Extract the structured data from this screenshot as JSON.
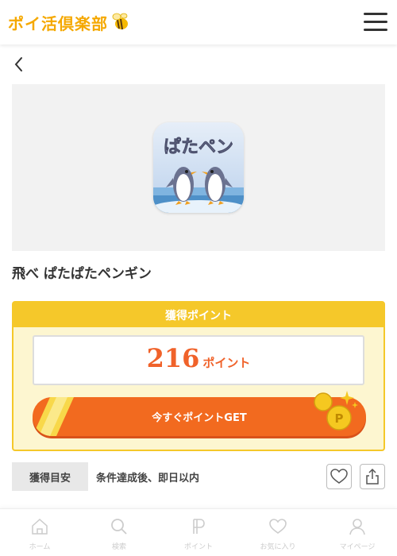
{
  "header": {
    "logo_text": "ポイ活倶楽部",
    "logo_icon": "bee-icon",
    "menu_icon": "hamburger-menu-icon"
  },
  "nav": {
    "back_icon": "chevron-left-icon"
  },
  "app": {
    "title": "飛べ ぱたぱたペンギン",
    "icon_text": "ぱたペン"
  },
  "points": {
    "header": "獲得ポイント",
    "value": "216",
    "unit": "ポイント",
    "cta_label": "今すぐポイントGET"
  },
  "criteria": {
    "label": "獲得目安",
    "text": "条件達成後、即日以内"
  },
  "actions": {
    "favorite_icon": "heart-icon",
    "share_icon": "share-icon"
  },
  "bottom_nav": {
    "items": [
      {
        "label": "ホーム",
        "icon": "home-icon"
      },
      {
        "label": "検索",
        "icon": "search-icon"
      },
      {
        "label": "ポイント",
        "icon": "point-icon"
      },
      {
        "label": "お気に入り",
        "icon": "heart-icon"
      },
      {
        "label": "マイページ",
        "icon": "user-icon"
      }
    ]
  },
  "colors": {
    "accent": "#f26a1f",
    "points_header": "#f5c82a",
    "points_bg": "#fdf6d0",
    "logo": "#f5a800"
  }
}
